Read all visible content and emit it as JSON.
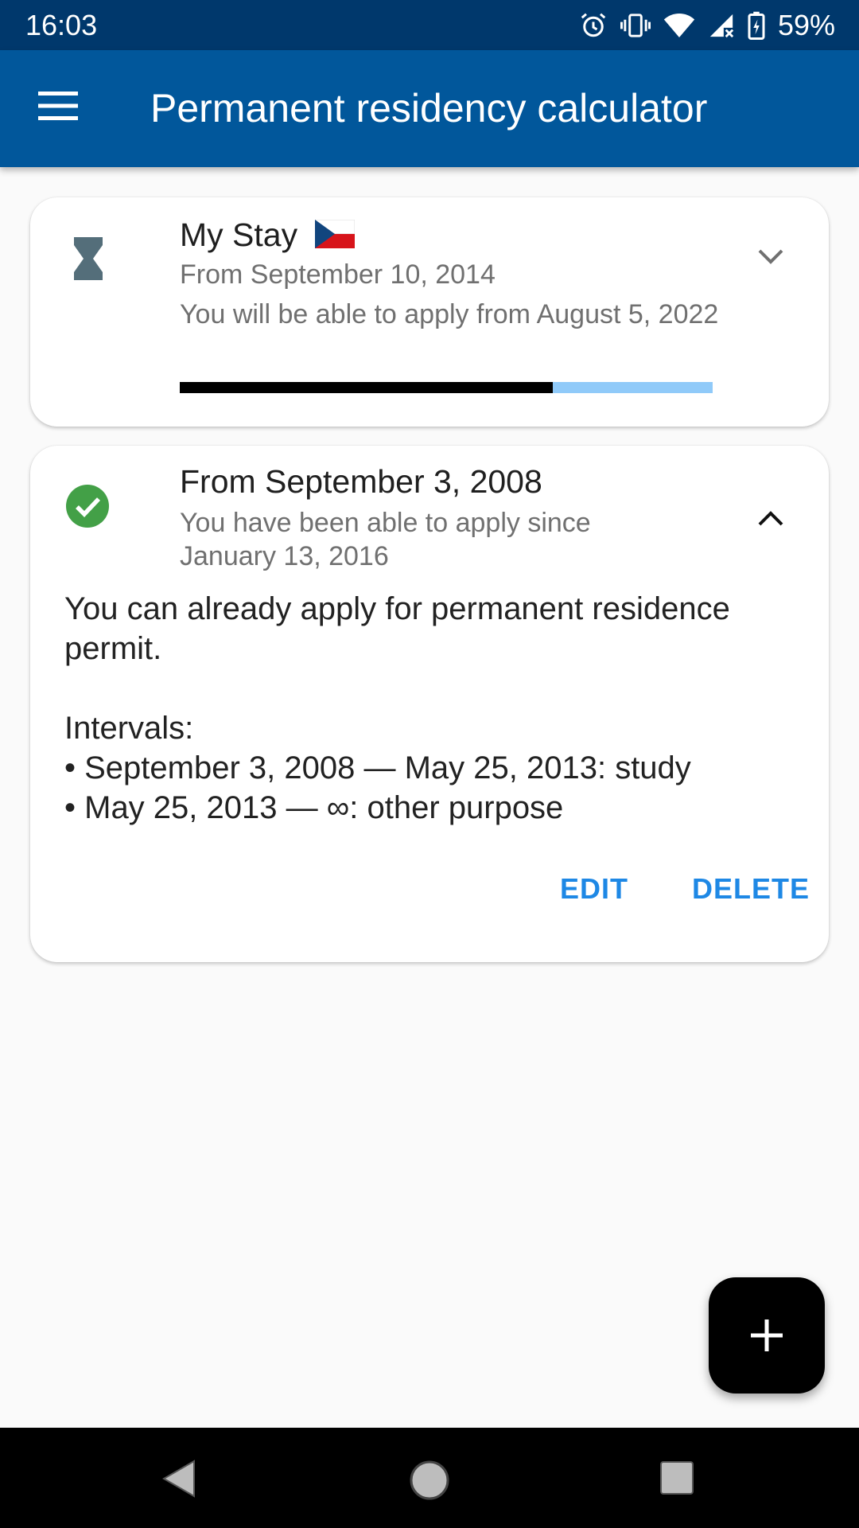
{
  "status_bar": {
    "time": "16:03",
    "battery_percent": "59%",
    "icons": [
      "alarm-icon",
      "vibrate-icon",
      "wifi-icon",
      "signal-icon",
      "battery-charging-icon"
    ]
  },
  "app_bar": {
    "title": "Permanent residency calculator",
    "menu_icon": "hamburger-menu-icon",
    "color": "#01579b"
  },
  "stays": [
    {
      "title": "My Stay",
      "flag": "czech-flag",
      "status_icon": "hourglass-icon",
      "from": "From September 10, 2014",
      "message": "You will be able to apply from August 5, 2022",
      "progress": 0.7,
      "expanded": false
    },
    {
      "title": "From September 3, 2008",
      "status_icon": "check-circle-icon",
      "message": "You have been able to apply since January 13, 2016",
      "expanded": true,
      "detail_text": "You can already apply for permanent residence permit.",
      "intervals_label": "Intervals:",
      "intervals": [
        "• September 3, 2008 — May 25, 2013: study",
        "• May 25, 2013 — ∞: other purpose"
      ],
      "actions": {
        "edit": "EDIT",
        "delete": "DELETE"
      }
    }
  ],
  "fab": {
    "icon": "plus-icon"
  },
  "nav_bar": {
    "icons": [
      "back-icon",
      "home-icon",
      "recents-icon"
    ]
  },
  "colors": {
    "accent": "#1e88e5",
    "check": "#43a047",
    "progress_track": "#90caf9"
  }
}
